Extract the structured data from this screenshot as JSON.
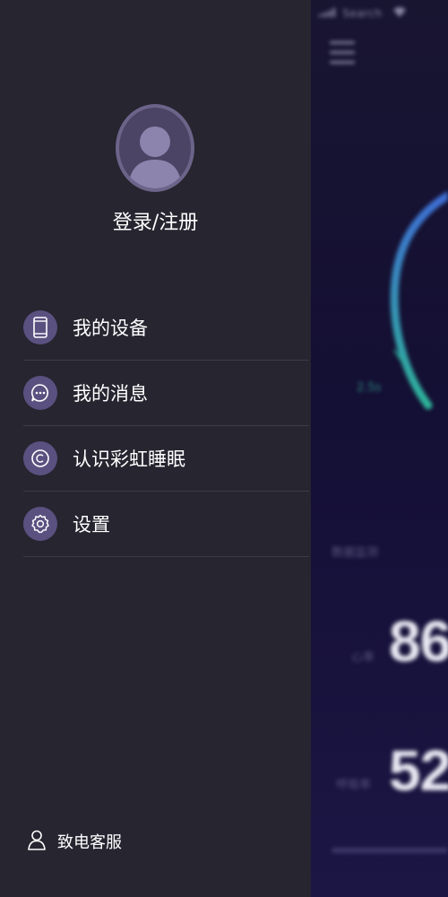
{
  "background_app": {
    "status_carrier": "Search",
    "speed_label": "2.5s",
    "section_label": "数据监测",
    "metric_1": {
      "label": "心率",
      "value": "86"
    },
    "metric_2": {
      "label": "呼吸率",
      "value": "52"
    }
  },
  "drawer": {
    "avatar_icon": "user-avatar-icon",
    "login_label": "登录/注册",
    "menu": [
      {
        "label": "我的设备",
        "icon": "phone-icon"
      },
      {
        "label": "我的消息",
        "icon": "chat-bubble-icon"
      },
      {
        "label": "认识彩虹睡眠",
        "icon": "copyright-icon"
      },
      {
        "label": "设置",
        "icon": "gear-icon"
      }
    ],
    "service_label": "致电客服",
    "service_icon": "person-icon"
  },
  "colors": {
    "drawer_bg": "#262530",
    "icon_circle": "#5a5180",
    "avatar_ring": "#6c6489",
    "divider": "#3d3b4a",
    "text": "#ffffff",
    "gauge_teal": "#2fb59a",
    "gauge_blue": "#3f6fd6"
  }
}
